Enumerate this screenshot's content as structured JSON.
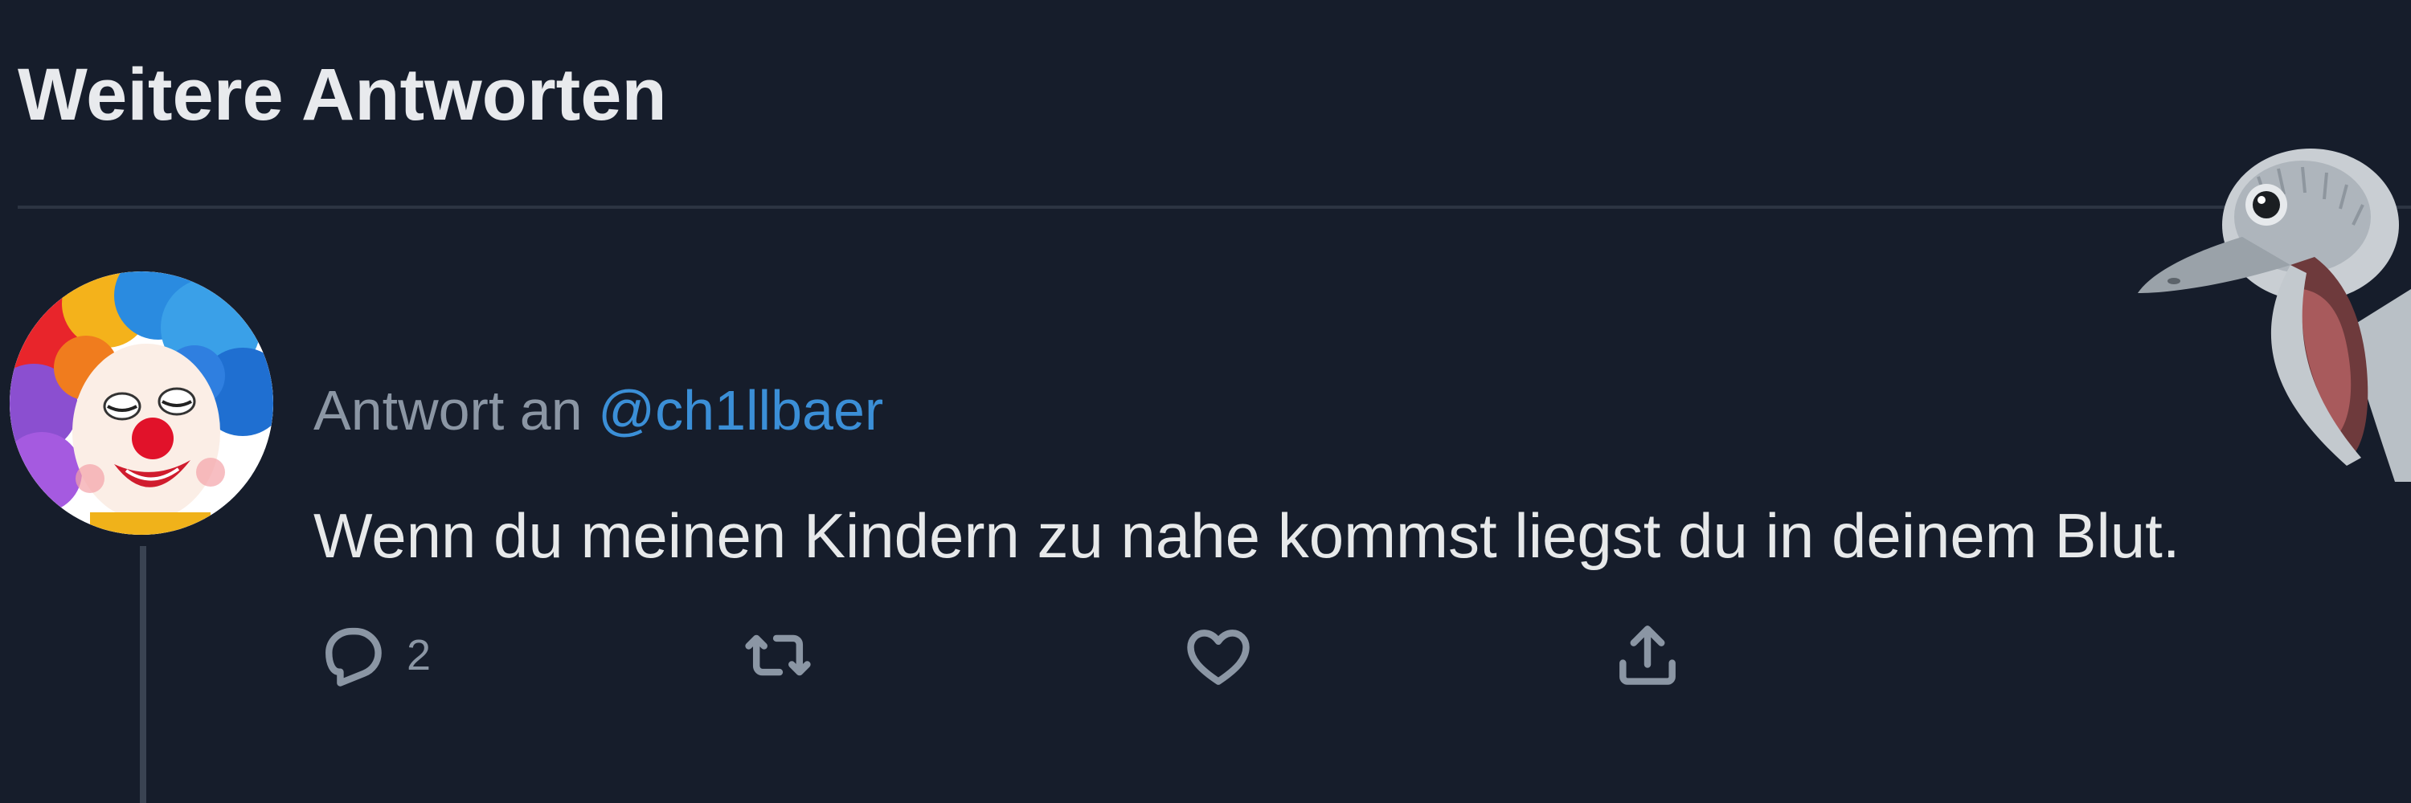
{
  "section": {
    "title": "Weitere Antworten"
  },
  "tweet": {
    "reply_prefix": "Antwort an ",
    "reply_mention": "@ch1llbaer",
    "text": "Wenn du meinen Kindern zu nahe kommst liegst du in deinem Blut.",
    "avatar_icon": "clown-avatar",
    "actions": {
      "reply": {
        "icon": "reply-icon",
        "count": "2"
      },
      "retweet": {
        "icon": "retweet-icon"
      },
      "like": {
        "icon": "heart-icon"
      },
      "share": {
        "icon": "share-icon"
      }
    }
  },
  "overlay": {
    "icon": "emu-sticker"
  },
  "colors": {
    "background": "#161d2b",
    "text": "#e7e9ea",
    "muted": "#8b96a4",
    "link": "#3b8fd7",
    "divider": "#2c3442"
  }
}
